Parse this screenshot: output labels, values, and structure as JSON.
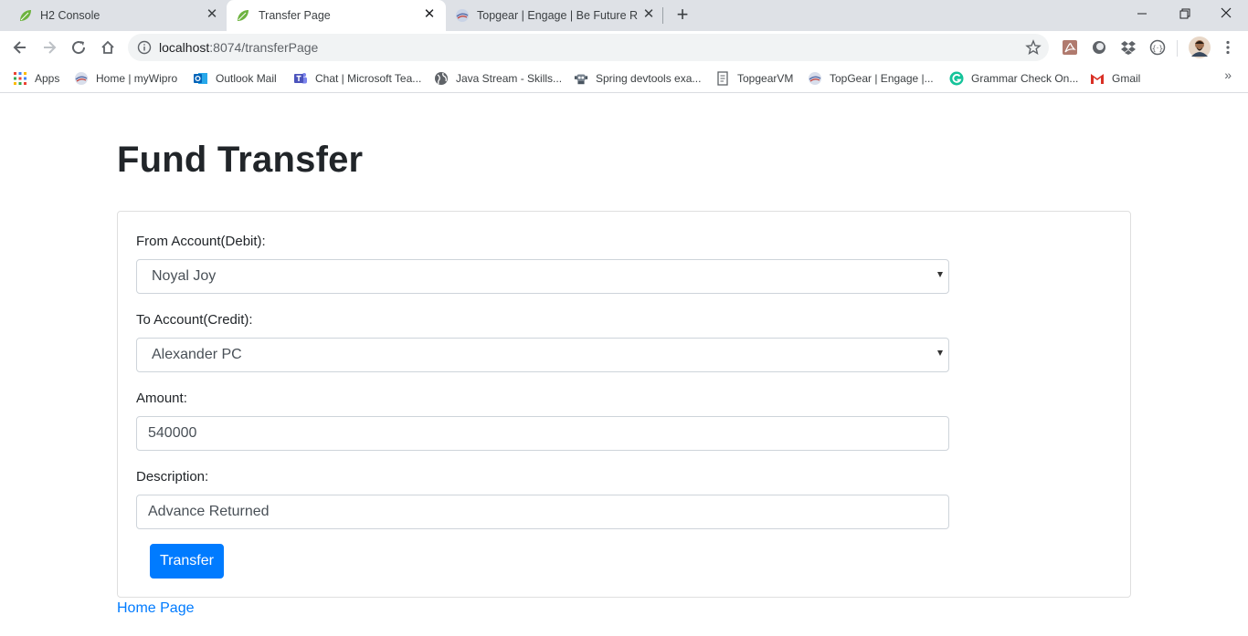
{
  "browser": {
    "tabs": [
      {
        "title": "H2 Console",
        "icon": "spring-leaf-icon"
      },
      {
        "title": "Transfer Page",
        "icon": "spring-leaf-icon"
      },
      {
        "title": "Topgear | Engage | Be Future Rea",
        "icon": "topgear-icon"
      }
    ],
    "url_host": "localhost",
    "url_rest": ":8074/transferPage",
    "bookmarks": [
      {
        "label": "Apps",
        "icon": "apps-grid-icon"
      },
      {
        "label": "Home | myWipro",
        "icon": "wipro-icon"
      },
      {
        "label": "Outlook Mail",
        "icon": "outlook-icon"
      },
      {
        "label": "Chat | Microsoft Tea...",
        "icon": "teams-icon"
      },
      {
        "label": "Java Stream - Skills...",
        "icon": "globe-icon"
      },
      {
        "label": "Spring devtools exa...",
        "icon": "robot-icon"
      },
      {
        "label": "TopgearVM",
        "icon": "page-icon"
      },
      {
        "label": "TopGear | Engage |...",
        "icon": "wipro-icon"
      },
      {
        "label": "Grammar Check On...",
        "icon": "grammarly-icon"
      },
      {
        "label": "Gmail",
        "icon": "gmail-icon"
      }
    ]
  },
  "page": {
    "title": "Fund Transfer",
    "form": {
      "from_label": "From Account(Debit):",
      "from_value": "Noyal Joy",
      "to_label": "To Account(Credit):",
      "to_value": "Alexander PC",
      "amount_label": "Amount:",
      "amount_value": "540000",
      "description_label": "Description:",
      "description_value": "Advance Returned",
      "submit_label": "Transfer"
    },
    "home_link": "Home Page"
  },
  "colors": {
    "primary": "#007bff",
    "tabstrip": "#dee1e6",
    "omnibox": "#f1f3f4"
  }
}
